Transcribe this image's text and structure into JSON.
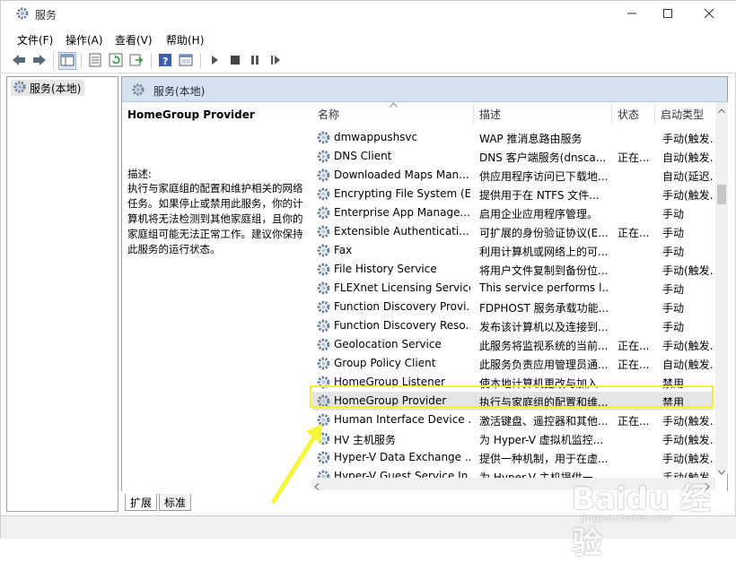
{
  "window": {
    "title": "服务",
    "controls": {
      "minimize": "minimize-icon",
      "maximize": "maximize-icon",
      "close": "close-icon"
    }
  },
  "menu": [
    "文件(F)",
    "操作(A)",
    "查看(V)",
    "帮助(H)"
  ],
  "tree": {
    "selected": "服务(本地)"
  },
  "pane": {
    "header": "服务(本地)",
    "selected_title": "HomeGroup Provider",
    "description_label": "描述:",
    "description_text": "执行与家庭组的配置和维护相关的网络任务。如果停止或禁用此服务，你的计算机将无法检测到其他家庭组，且你的家庭组可能无法正常工作。建议你保持此服务的运行状态。"
  },
  "columns": {
    "name": "名称",
    "description": "描述",
    "status": "状态",
    "startup": "启动类型"
  },
  "services": [
    {
      "name": "dmwappushsvc",
      "desc": "WAP 推消息路由服务",
      "status": "",
      "startup": "手动(触发..."
    },
    {
      "name": "DNS Client",
      "desc": "DNS 客户端服务(dnsca...",
      "status": "正在...",
      "startup": "自动(触发..."
    },
    {
      "name": "Downloaded Maps Man...",
      "desc": "供应用程序访问已下载地...",
      "status": "",
      "startup": "自动(延迟..."
    },
    {
      "name": "Encrypting File System (E...",
      "desc": "提供用于在 NTFS 文件...",
      "status": "",
      "startup": "手动(触发..."
    },
    {
      "name": "Enterprise App Manage...",
      "desc": "启用企业应用程序管理。",
      "status": "",
      "startup": "手动"
    },
    {
      "name": "Extensible Authenticati...",
      "desc": "可扩展的身份验证协议(E...",
      "status": "正在...",
      "startup": "手动"
    },
    {
      "name": "Fax",
      "desc": "利用计算机或网络上的可...",
      "status": "",
      "startup": "手动"
    },
    {
      "name": "File History Service",
      "desc": "将用户文件复制到备份位...",
      "status": "",
      "startup": "手动(触发..."
    },
    {
      "name": "FLEXnet Licensing Service",
      "desc": "This service performs l...",
      "status": "",
      "startup": "手动"
    },
    {
      "name": "Function Discovery Provi...",
      "desc": "FDPHOST 服务承载功能...",
      "status": "",
      "startup": "手动"
    },
    {
      "name": "Function Discovery Reso...",
      "desc": "发布该计算机以及连接到...",
      "status": "",
      "startup": "手动"
    },
    {
      "name": "Geolocation Service",
      "desc": "此服务将监视系统的当前...",
      "status": "正在...",
      "startup": "手动(触发..."
    },
    {
      "name": "Group Policy Client",
      "desc": "此服务负责应用管理员通...",
      "status": "正在...",
      "startup": "自动(触发..."
    },
    {
      "name": "HomeGroup Listener",
      "desc": "使本地计算机更改与加入...",
      "status": "",
      "startup": "禁用"
    },
    {
      "name": "HomeGroup Provider",
      "desc": "执行与家庭组的配置和维...",
      "status": "",
      "startup": "禁用"
    },
    {
      "name": "Human Interface Device ...",
      "desc": "激活键盘、遥控器和其他...",
      "status": "正在...",
      "startup": "手动(触发..."
    },
    {
      "name": "HV 主机服务",
      "desc": "为 Hyper-V 虚拟机监控...",
      "status": "",
      "startup": "手动(触发..."
    },
    {
      "name": "Hyper-V Data Exchange ...",
      "desc": "提供一种机制，用于在虚...",
      "status": "",
      "startup": "手动(触发..."
    },
    {
      "name": "Hyper-V Guest Service In...",
      "desc": "为 Hyper-V 主机提供一...",
      "status": "",
      "startup": "手动(触发..."
    }
  ],
  "selected_index": 14,
  "tabs": [
    "扩展",
    "标准"
  ],
  "active_tab": "扩展",
  "watermark": {
    "main": "Baidu 经验",
    "sub": "jingyan.baidu.com"
  },
  "colors": {
    "header_bg": "#d6e2ee",
    "highlight_box": "#f2f22a",
    "arrow": "#f5f53a"
  }
}
